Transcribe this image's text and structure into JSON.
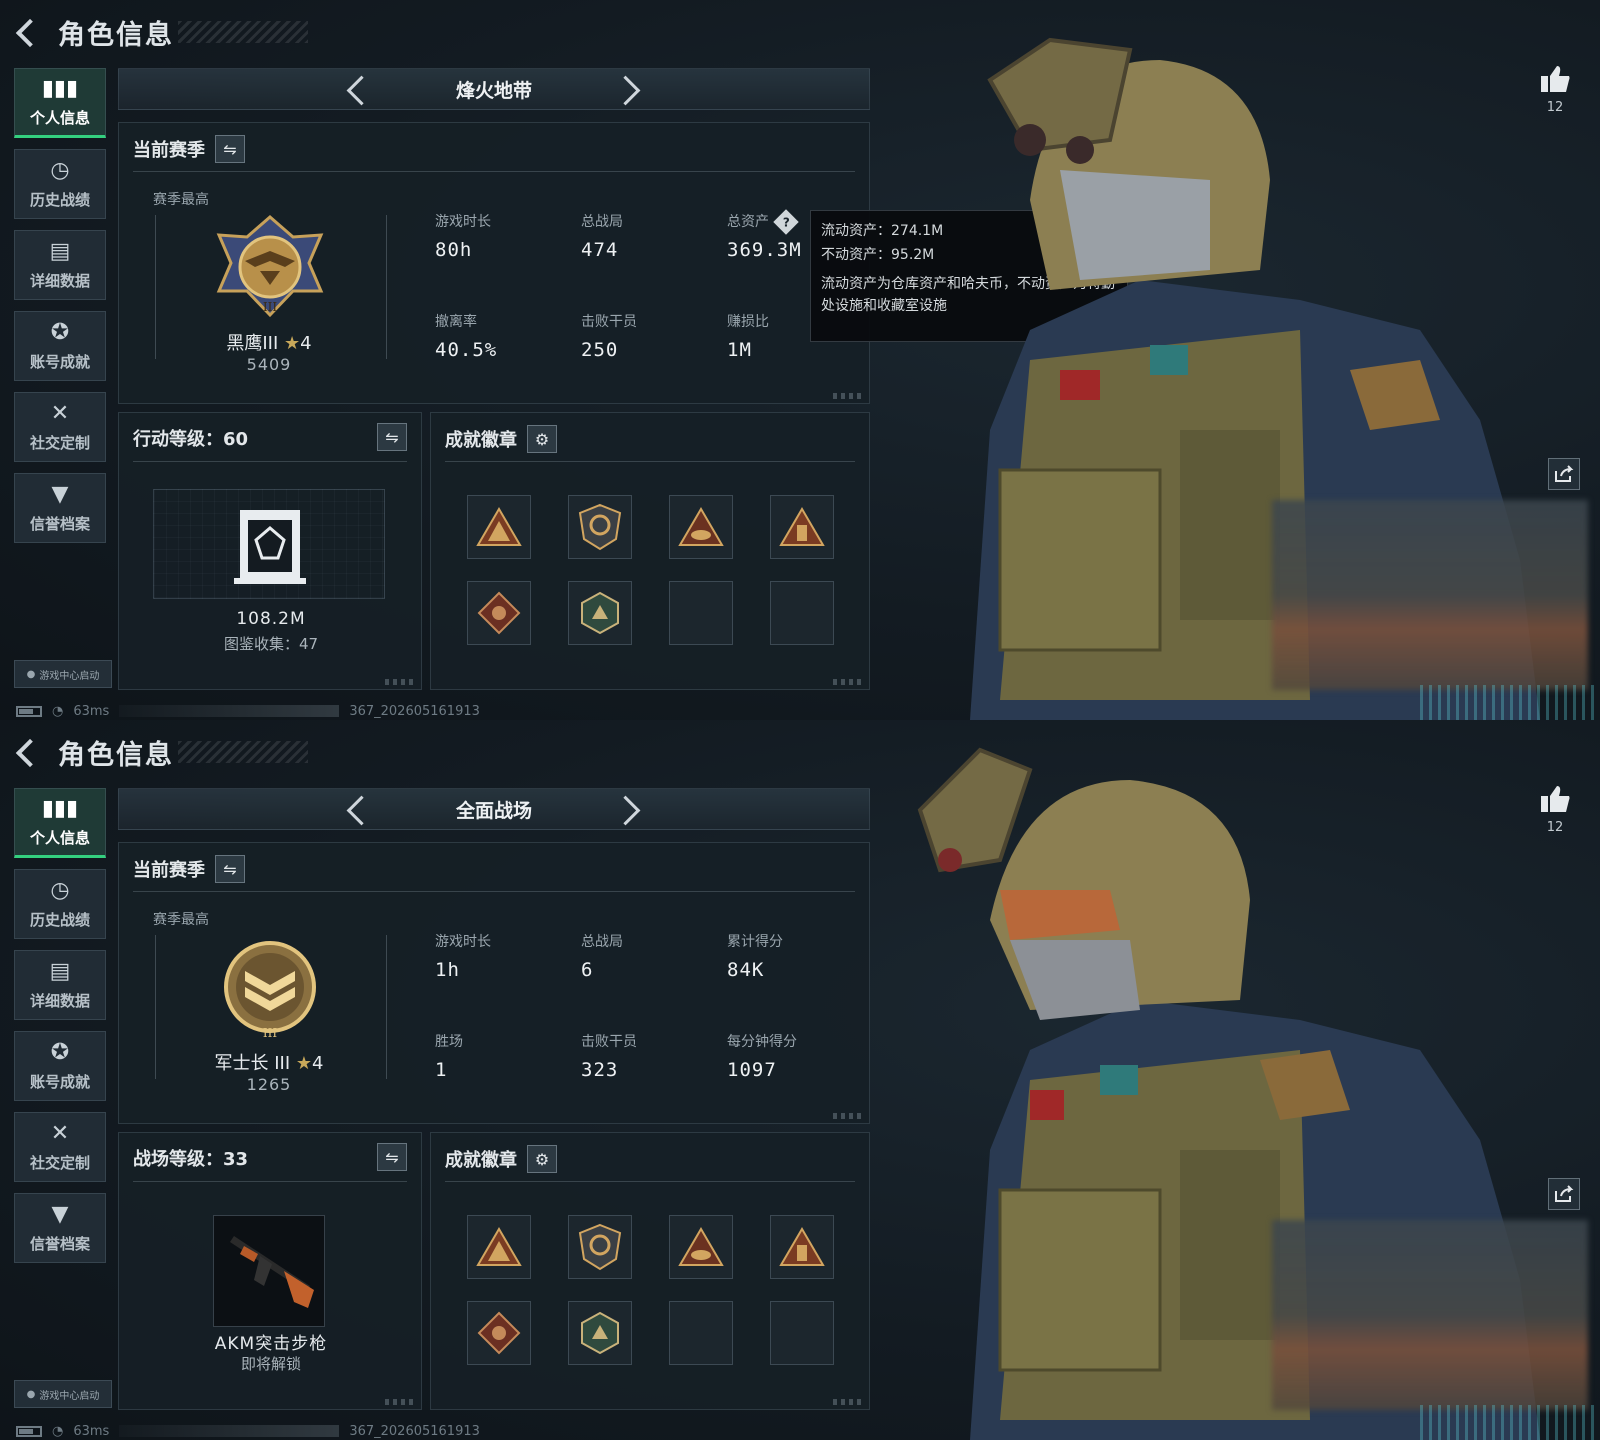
{
  "screens": [
    {
      "header": {
        "title": "角色信息"
      },
      "sidebar": [
        {
          "icon": "bar-chart-icon",
          "label": "个人信息",
          "active": true
        },
        {
          "icon": "clock-icon",
          "label": "历史战绩"
        },
        {
          "icon": "folder-icon",
          "label": "详细数据"
        },
        {
          "icon": "trophy-icon",
          "label": "账号成就"
        },
        {
          "icon": "tools-icon",
          "label": "社交定制"
        },
        {
          "icon": "credit-icon",
          "label": "信誉档案"
        }
      ],
      "launch_badge": "游戏中心启动",
      "status": {
        "ping": "63ms",
        "build": "367_202605161913"
      },
      "mode": "烽火地带",
      "season": {
        "title": "当前赛季",
        "sub_label": "赛季最高",
        "rank_name": "黑鹰III",
        "rank_stars": "4",
        "rank_score": "5409",
        "stats": [
          {
            "label": "游戏时长",
            "value": "80h"
          },
          {
            "label": "总战局",
            "value": "474"
          },
          {
            "label": "总资产",
            "value": "369.3M"
          },
          {
            "label": "撤离率",
            "value": "40.5%"
          },
          {
            "label": "击败干员",
            "value": "250"
          },
          {
            "label": "赚损比",
            "value": "1M"
          }
        ]
      },
      "tooltip": {
        "liquid": "流动资产：274.1M",
        "fixed": "不动资产：95.2M",
        "note": "流动资产为仓库资产和哈夫币，不动资产为特勤处设施和收藏室设施"
      },
      "level": {
        "title": "行动等级：60",
        "value": "108.2M",
        "sub": "图鉴收集：47"
      },
      "badges": {
        "title": "成就徽章"
      },
      "likes": "12"
    },
    {
      "header": {
        "title": "角色信息"
      },
      "sidebar": [
        {
          "icon": "bar-chart-icon",
          "label": "个人信息",
          "active": true
        },
        {
          "icon": "clock-icon",
          "label": "历史战绩"
        },
        {
          "icon": "folder-icon",
          "label": "详细数据"
        },
        {
          "icon": "trophy-icon",
          "label": "账号成就"
        },
        {
          "icon": "tools-icon",
          "label": "社交定制"
        },
        {
          "icon": "credit-icon",
          "label": "信誉档案"
        }
      ],
      "launch_badge": "游戏中心启动",
      "status": {
        "ping": "63ms",
        "build": "367_202605161913"
      },
      "mode": "全面战场",
      "season": {
        "title": "当前赛季",
        "sub_label": "赛季最高",
        "rank_name": "军士长 III",
        "rank_stars": "4",
        "rank_score": "1265",
        "stats": [
          {
            "label": "游戏时长",
            "value": "1h"
          },
          {
            "label": "总战局",
            "value": "6"
          },
          {
            "label": "累计得分",
            "value": "84K"
          },
          {
            "label": "胜场",
            "value": "1"
          },
          {
            "label": "击败干员",
            "value": "323"
          },
          {
            "label": "每分钟得分",
            "value": "1097"
          }
        ]
      },
      "level": {
        "title": "战场等级：33",
        "value": "AKM突击步枪",
        "sub": "即将解锁"
      },
      "badges": {
        "title": "成就徽章"
      },
      "likes": "12"
    }
  ],
  "colors": {
    "accent": "#34d07f",
    "gold": "#c8a85a",
    "panel": "#161f26"
  }
}
